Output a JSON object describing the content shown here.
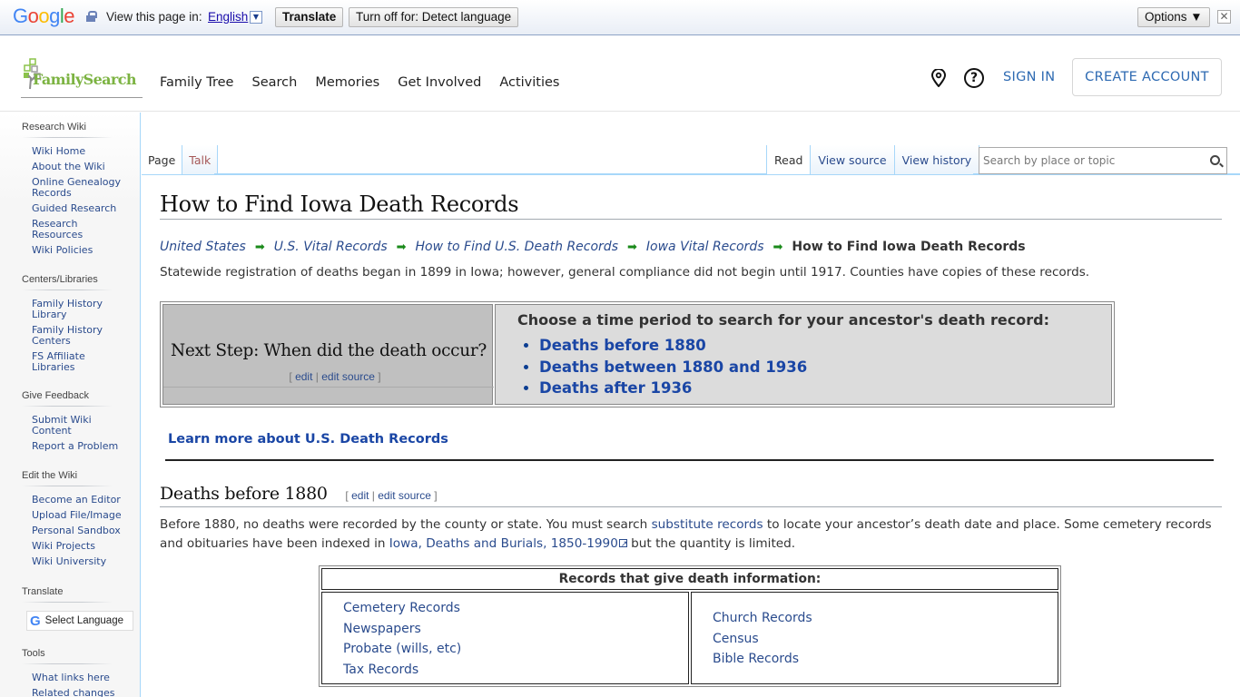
{
  "translate_bar": {
    "brand": "Google",
    "view_label": "View this page in:",
    "language": "English",
    "translate_button": "Translate",
    "turn_off_button": "Turn off for: Detect language",
    "options_button": "Options ▼",
    "close": "✕"
  },
  "header": {
    "logo_text": "FamilySearch",
    "nav": [
      "Family Tree",
      "Search",
      "Memories",
      "Get Involved",
      "Activities"
    ],
    "help": "?",
    "sign_in": "SIGN IN",
    "create_account": "CREATE ACCOUNT"
  },
  "sidebar": {
    "sections": [
      {
        "title": "Research Wiki",
        "items": [
          "Wiki Home",
          "About the Wiki",
          "Online Genealogy Records",
          "Guided Research",
          "Research Resources",
          "Wiki Policies"
        ]
      },
      {
        "title": "Centers/Libraries",
        "items": [
          "Family History Library",
          "Family History Centers",
          "FS Affiliate Libraries"
        ]
      },
      {
        "title": "Give Feedback",
        "items": [
          "Submit Wiki Content",
          "Report a Problem"
        ]
      },
      {
        "title": "Edit the Wiki",
        "items": [
          "Become an Editor",
          "Upload File/Image",
          "Personal Sandbox",
          "Wiki Projects",
          "Wiki University"
        ]
      },
      {
        "title": "Translate",
        "select_language": "Select Language"
      },
      {
        "title": "Tools",
        "items": [
          "What links here",
          "Related changes"
        ]
      }
    ]
  },
  "tabs": {
    "left": [
      "Page",
      "Talk"
    ],
    "right": [
      "Read",
      "View source",
      "View history"
    ],
    "search_placeholder": "Search by place or topic"
  },
  "article": {
    "title": "How to Find Iowa Death Records",
    "breadcrumbs": [
      "United States",
      "U.S. Vital Records",
      "How to Find U.S. Death Records",
      "Iowa Vital Records"
    ],
    "breadcrumb_current": "How to Find Iowa Death Records",
    "breadcrumb_separator": "➡",
    "intro": "Statewide registration of deaths began in 1899 in Iowa; however, general compliance did not begin until 1917. Counties have copies of these records.",
    "next_step": {
      "question": "Next Step: When did the death occur?",
      "edit": "edit",
      "edit_source": "edit source",
      "choose_heading": "Choose a time period to search for your ancestor's death record:",
      "options": [
        "Deaths before 1880",
        "Deaths between 1880 and 1936",
        "Deaths after 1936"
      ]
    },
    "learn_more": "Learn more about U.S. Death Records",
    "section": {
      "heading": "Deaths before 1880",
      "edit": "edit",
      "edit_source": "edit source",
      "p_part1": "Before 1880, no deaths were recorded by the county or state. You must search ",
      "link1": "substitute records",
      "p_part2": " to locate your ancestor’s death date and place. Some cemetery records and obituaries have been indexed in ",
      "link2": "Iowa, Deaths and Burials, 1850-1990",
      "p_part3": " but the quantity is limited."
    },
    "records_table": {
      "heading": "Records that give death information:",
      "col1": [
        "Cemetery Records",
        "Newspapers",
        "Probate (wills, etc)",
        "Tax Records"
      ],
      "col2": [
        "Church Records",
        "Census",
        "Bible Records"
      ]
    }
  }
}
